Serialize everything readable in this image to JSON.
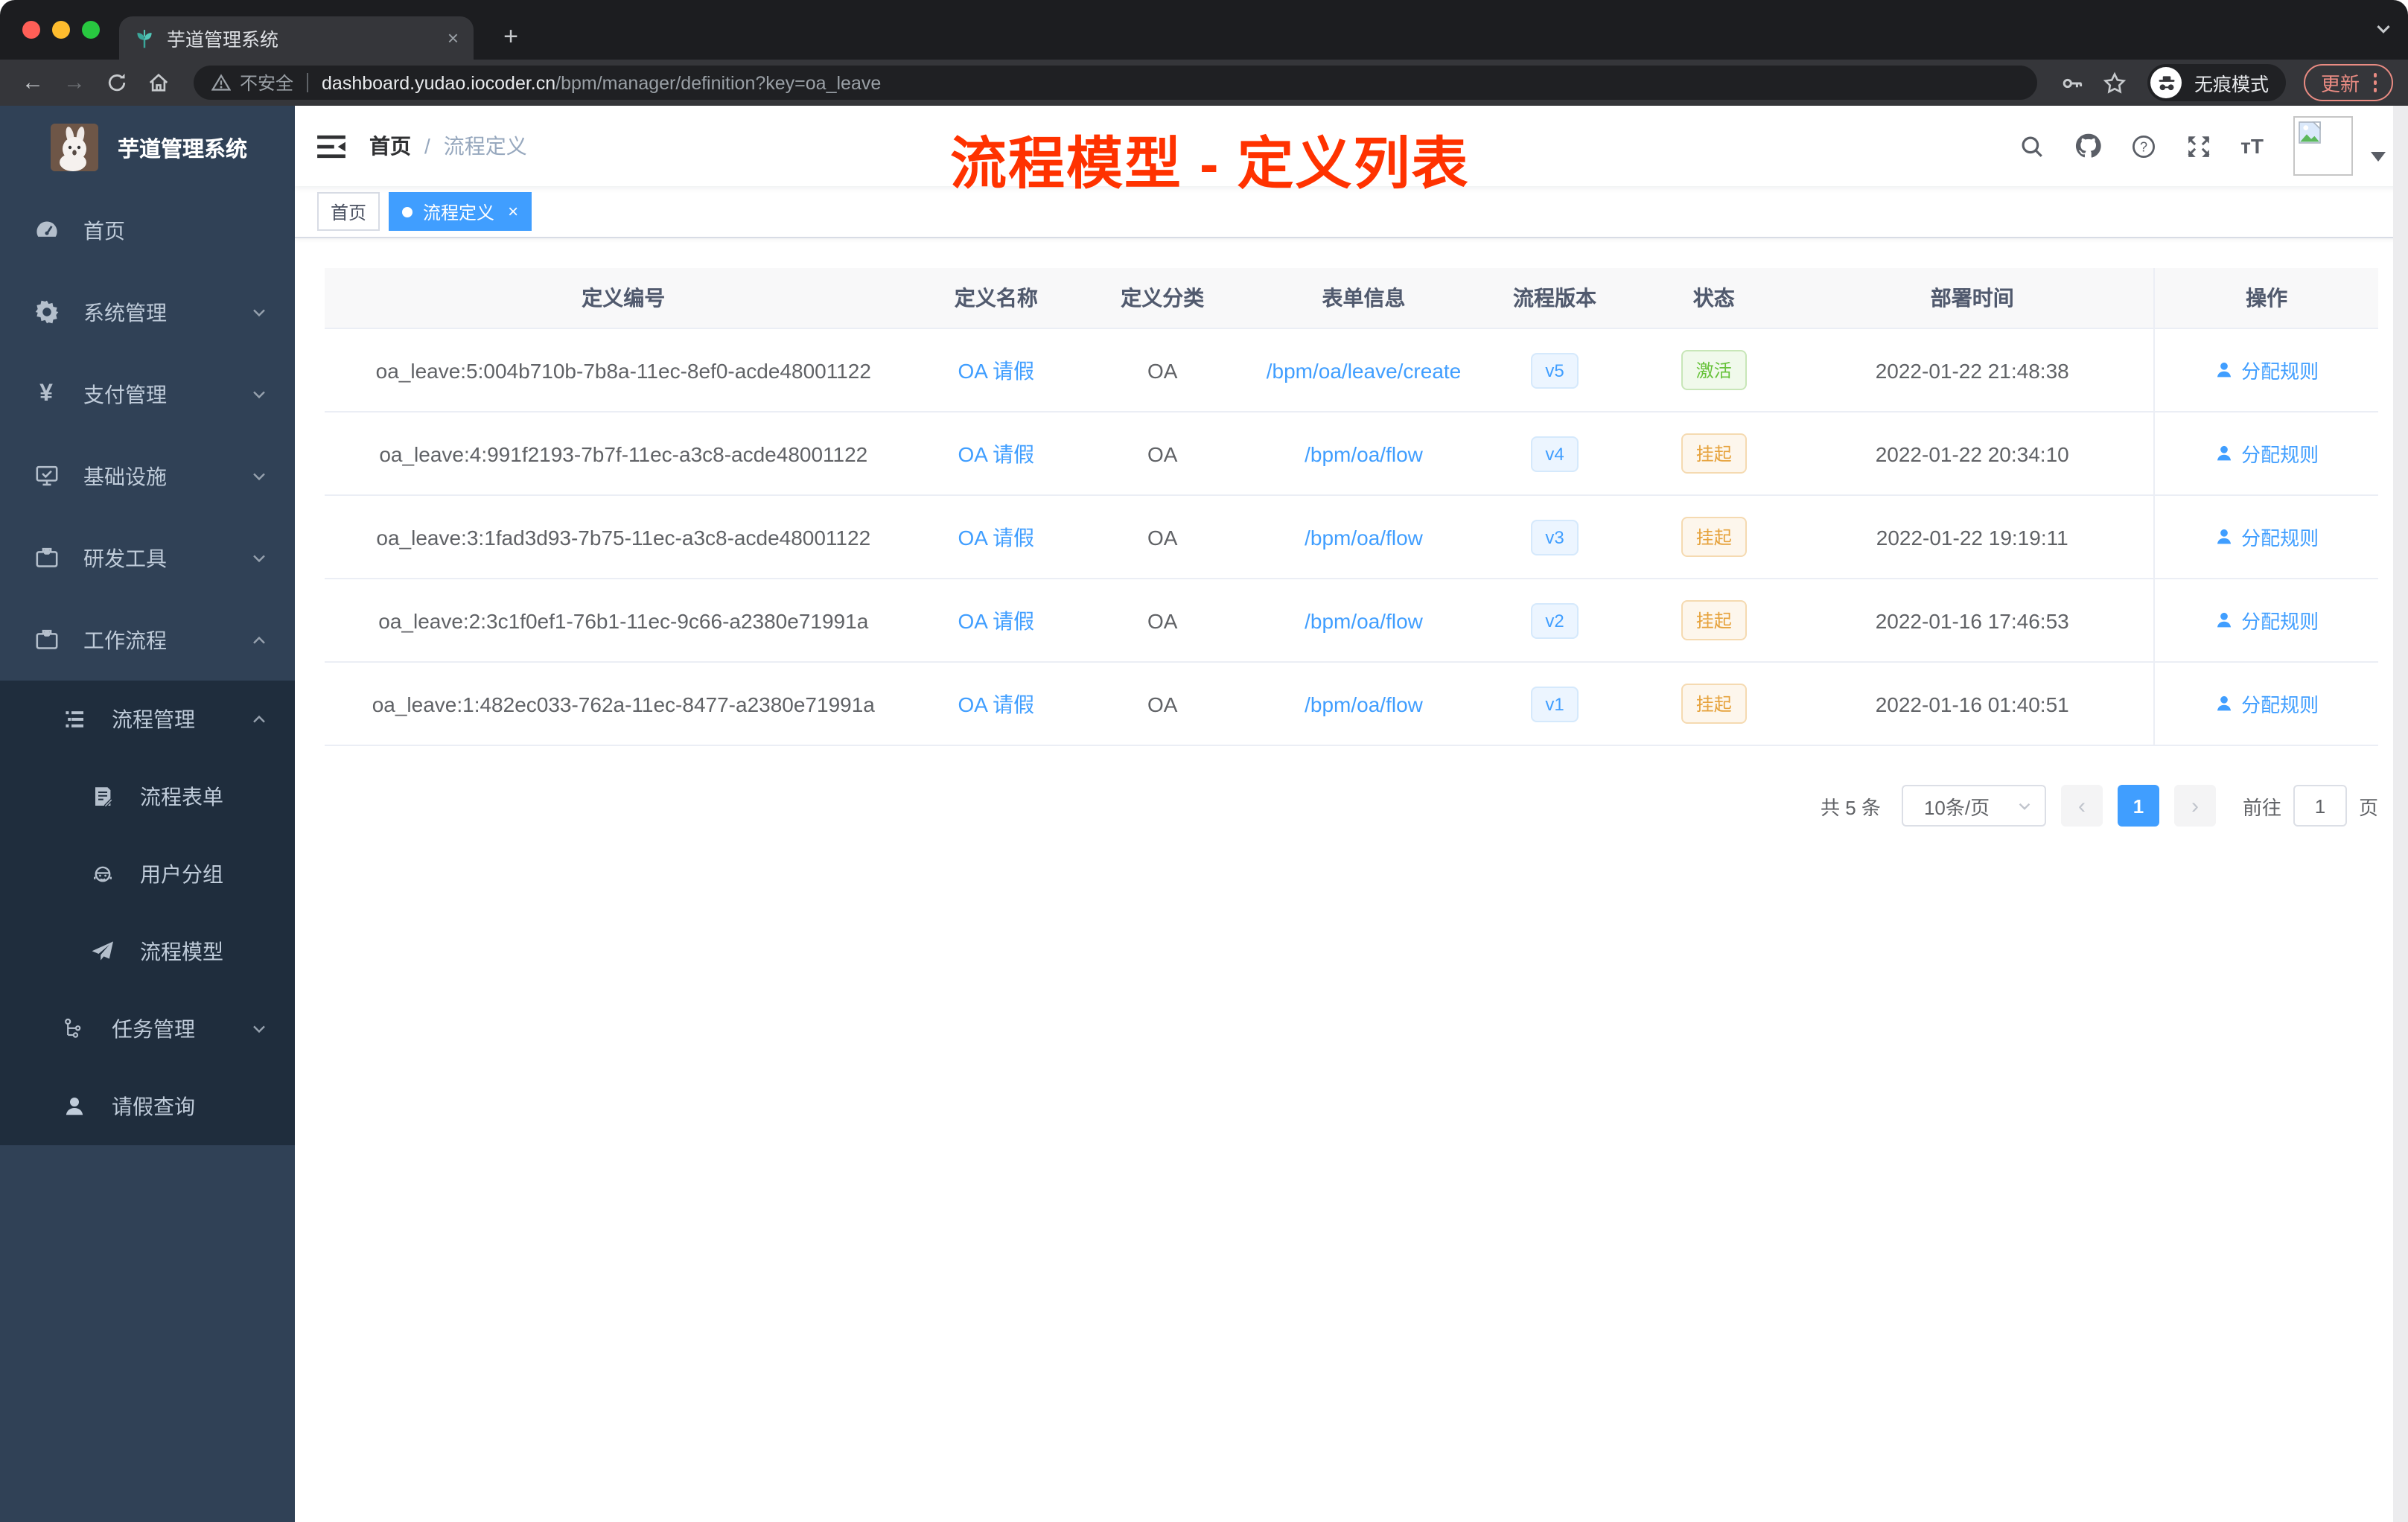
{
  "browser": {
    "tab": {
      "title": "芋道管理系统",
      "close": "×",
      "new_tab": "+"
    },
    "toolbar": {
      "security_label": "不安全",
      "url_host": "dashboard.yudao.iocoder.cn",
      "url_path": "/bpm/manager/definition?key=oa_leave",
      "incognito_label": "无痕模式",
      "update_label": "更新"
    }
  },
  "sidebar": {
    "app_title": "芋道管理系统",
    "items": [
      {
        "label": "首页",
        "icon": "dashboard-icon"
      },
      {
        "label": "系统管理",
        "icon": "gear-icon",
        "arrow": "down"
      },
      {
        "label": "支付管理",
        "icon": "yen-icon",
        "arrow": "down"
      },
      {
        "label": "基础设施",
        "icon": "monitor-icon",
        "arrow": "down"
      },
      {
        "label": "研发工具",
        "icon": "briefcase-icon",
        "arrow": "down"
      },
      {
        "label": "工作流程",
        "icon": "briefcase-icon",
        "arrow": "up"
      }
    ],
    "sub": [
      {
        "label": "流程管理",
        "icon": "list-icon",
        "arrow": "up",
        "level": 2
      },
      {
        "label": "流程表单",
        "icon": "form-icon",
        "level": 3
      },
      {
        "label": "用户分组",
        "icon": "user-group-icon",
        "level": 3
      },
      {
        "label": "流程模型",
        "icon": "paper-plane-icon",
        "level": 3
      },
      {
        "label": "任务管理",
        "icon": "tree-icon",
        "arrow": "down",
        "level": 2
      },
      {
        "label": "请假查询",
        "icon": "person-icon",
        "level": 2
      }
    ]
  },
  "header": {
    "breadcrumb": {
      "home": "首页",
      "separator": "/",
      "current": "流程定义"
    },
    "annotation": "流程模型 - 定义列表"
  },
  "tags": {
    "items": [
      {
        "label": "首页",
        "active": false
      },
      {
        "label": "流程定义",
        "active": true,
        "close": "×"
      }
    ]
  },
  "table": {
    "columns": [
      "定义编号",
      "定义名称",
      "定义分类",
      "表单信息",
      "流程版本",
      "状态",
      "部署时间",
      "操作"
    ],
    "rows": [
      {
        "id": "oa_leave:5:004b710b-7b8a-11ec-8ef0-acde48001122",
        "name": "OA 请假",
        "category": "OA",
        "form": "/bpm/oa/leave/create",
        "version": "v5",
        "status": "激活",
        "status_type": "success",
        "deployed_at": "2022-01-22 21:48:38",
        "action": "分配规则"
      },
      {
        "id": "oa_leave:4:991f2193-7b7f-11ec-a3c8-acde48001122",
        "name": "OA 请假",
        "category": "OA",
        "form": "/bpm/oa/flow",
        "version": "v4",
        "status": "挂起",
        "status_type": "warning",
        "deployed_at": "2022-01-22 20:34:10",
        "action": "分配规则"
      },
      {
        "id": "oa_leave:3:1fad3d93-7b75-11ec-a3c8-acde48001122",
        "name": "OA 请假",
        "category": "OA",
        "form": "/bpm/oa/flow",
        "version": "v3",
        "status": "挂起",
        "status_type": "warning",
        "deployed_at": "2022-01-22 19:19:11",
        "action": "分配规则"
      },
      {
        "id": "oa_leave:2:3c1f0ef1-76b1-11ec-9c66-a2380e71991a",
        "name": "OA 请假",
        "category": "OA",
        "form": "/bpm/oa/flow",
        "version": "v2",
        "status": "挂起",
        "status_type": "warning",
        "deployed_at": "2022-01-16 17:46:53",
        "action": "分配规则"
      },
      {
        "id": "oa_leave:1:482ec033-762a-11ec-8477-a2380e71991a",
        "name": "OA 请假",
        "category": "OA",
        "form": "/bpm/oa/flow",
        "version": "v1",
        "status": "挂起",
        "status_type": "warning",
        "deployed_at": "2022-01-16 01:40:51",
        "action": "分配规则"
      }
    ]
  },
  "pagination": {
    "total": "共 5 条",
    "page_size": "10条/页",
    "prev": "‹",
    "page": "1",
    "next": "›",
    "goto_label": "前往",
    "goto_value": "1",
    "unit_label": "页"
  },
  "colors": {
    "accent": "#409EFF",
    "success": "#67C23A",
    "warning": "#E6A23C",
    "sidebar_bg": "#304156",
    "submenu_bg": "#1F2D3D",
    "annotation": "#FF3200"
  }
}
